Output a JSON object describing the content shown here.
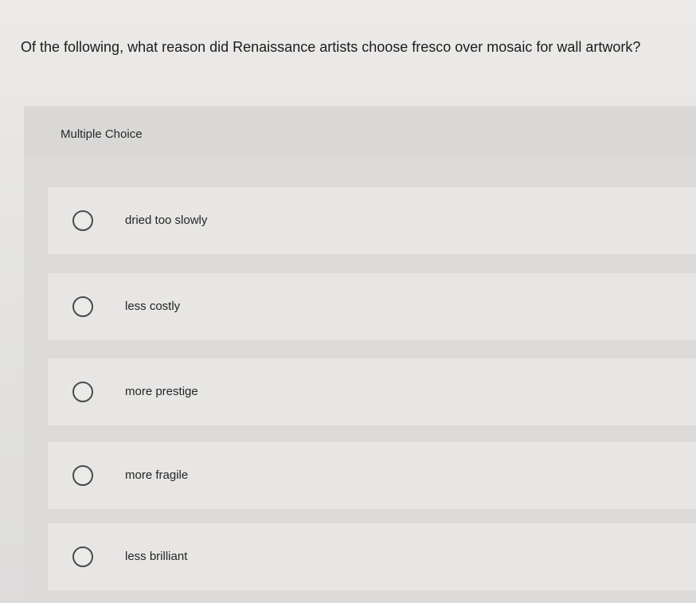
{
  "question": {
    "text": "Of the following, what reason did Renaissance artists choose fresco over mosaic for wall artwork?"
  },
  "section": {
    "label": "Multiple Choice"
  },
  "choices": [
    {
      "label": "dried too slowly",
      "selected": false,
      "icon": "radio-unselected-icon"
    },
    {
      "label": "less costly",
      "selected": false,
      "icon": "radio-unselected-icon"
    },
    {
      "label": "more prestige",
      "selected": false,
      "icon": "radio-unselected-icon"
    },
    {
      "label": "more fragile",
      "selected": false,
      "icon": "radio-unselected-icon"
    },
    {
      "label": "less brilliant",
      "selected": false,
      "icon": "radio-unselected-icon"
    }
  ],
  "colors": {
    "background": "#e6e5e3",
    "header_band": "#d9d8d6",
    "choice_card": "#e7e6e4",
    "radio_border": "#4a4a4a"
  }
}
